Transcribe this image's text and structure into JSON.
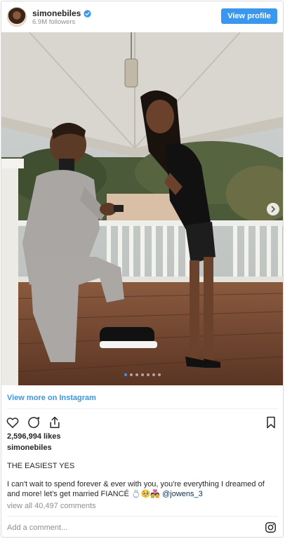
{
  "header": {
    "username": "simonebiles",
    "followers": "6.9M followers",
    "view_profile_label": "View profile"
  },
  "carousel": {
    "total": 7,
    "active_index": 0
  },
  "view_more_label": "View more on Instagram",
  "post": {
    "likes": "2,596,994 likes",
    "caption_user": "simonebiles",
    "caption_title": "THE EASIEST YES",
    "caption_body": "I can't wait to spend forever & ever with you, you're everything I dreamed of and more! let's get married FIANCÉ 💍🥺💑",
    "mention": "@jowens_3",
    "view_comments": "view all 40,497 comments"
  },
  "comment_box": {
    "placeholder": "Add a comment..."
  },
  "colors": {
    "accent": "#3897f0",
    "text": "#262626",
    "muted": "#8e8e8e"
  },
  "icons": [
    "verified-badge-icon",
    "heart-icon",
    "comment-icon",
    "share-icon",
    "bookmark-icon",
    "instagram-icon",
    "chevron-right-icon"
  ]
}
